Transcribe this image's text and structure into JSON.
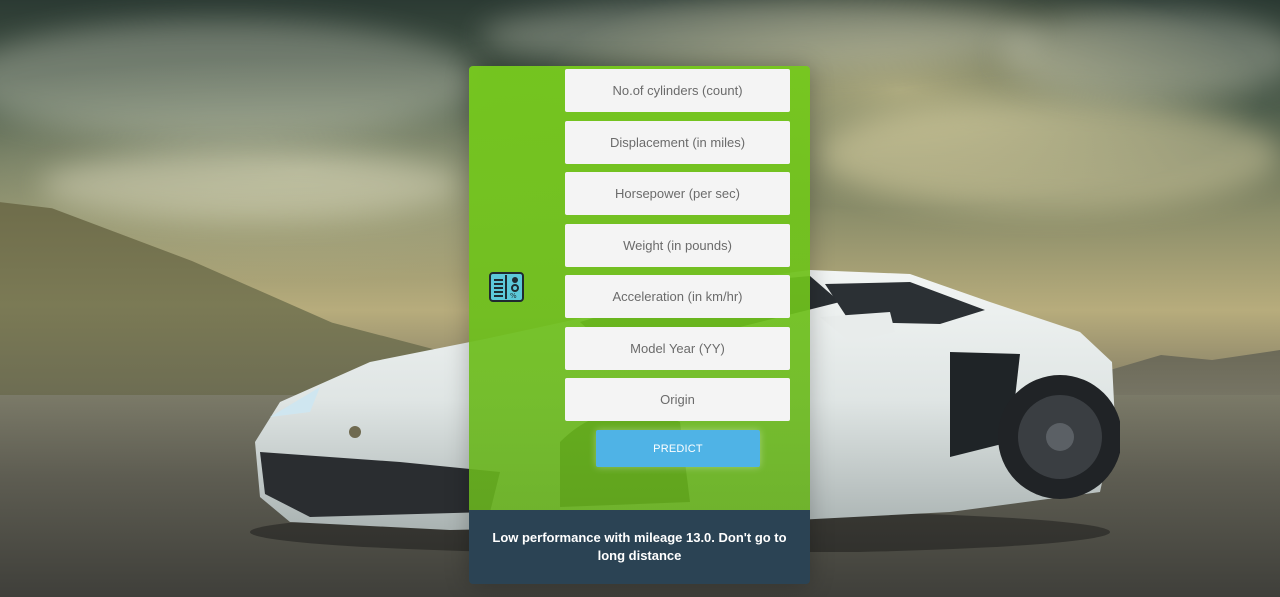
{
  "form": {
    "fields": [
      {
        "placeholder": "No.of cylinders (count)",
        "value": ""
      },
      {
        "placeholder": "Displacement (in miles)",
        "value": ""
      },
      {
        "placeholder": "Horsepower (per sec)",
        "value": ""
      },
      {
        "placeholder": "Weight (in pounds)",
        "value": ""
      },
      {
        "placeholder": "Acceleration (in km/hr)",
        "value": ""
      },
      {
        "placeholder": "Model Year (YY)",
        "value": ""
      },
      {
        "placeholder": "Origin",
        "value": ""
      }
    ],
    "predict_label": "PREDICT",
    "icon": "spec-sheet-icon"
  },
  "result": {
    "text": "Low performance with mileage 13.0. Don't go to long distance"
  },
  "colors": {
    "panel_green": "#76c81e",
    "button_blue": "#4fb3e6",
    "result_bg": "#2b4354",
    "field_bg": "#f4f4f4"
  }
}
